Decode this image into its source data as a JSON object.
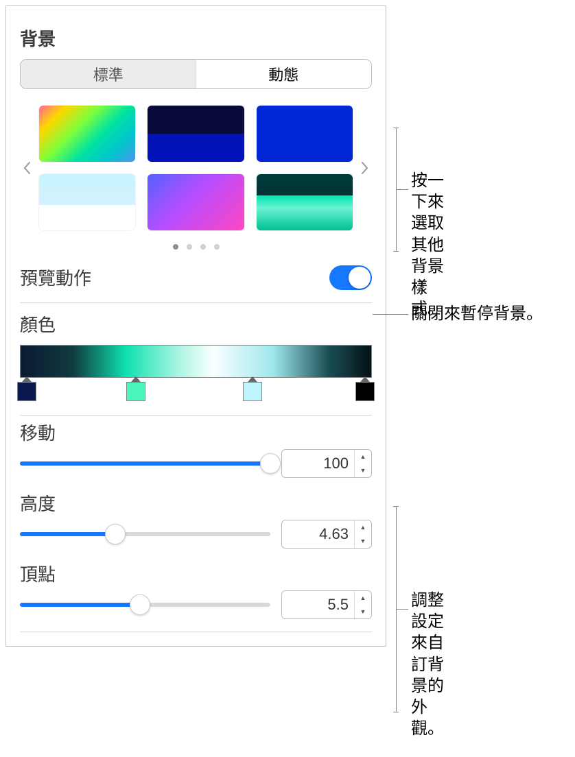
{
  "section_bg_title": "背景",
  "seg_standard": "標準",
  "seg_dynamic": "動態",
  "preview_motion_label": "預覽動作",
  "color_label": "顏色",
  "color_stops": [
    {
      "pos": 2,
      "color": "#0a1850"
    },
    {
      "pos": 33,
      "color": "#4af5b9"
    },
    {
      "pos": 66,
      "color": "#bff5ff"
    },
    {
      "pos": 98,
      "color": "#000000"
    }
  ],
  "sliders": {
    "move": {
      "label": "移動",
      "value": "100",
      "percent": 100
    },
    "height": {
      "label": "高度",
      "value": "4.63",
      "percent": 38
    },
    "apex": {
      "label": "頂點",
      "value": "5.5",
      "percent": 48
    }
  },
  "callout_gallery": "按一下來選取其他背景樣式。",
  "callout_toggle": "關閉來暫停背景。",
  "callout_sliders": "調整設定來自訂背景的外觀。"
}
